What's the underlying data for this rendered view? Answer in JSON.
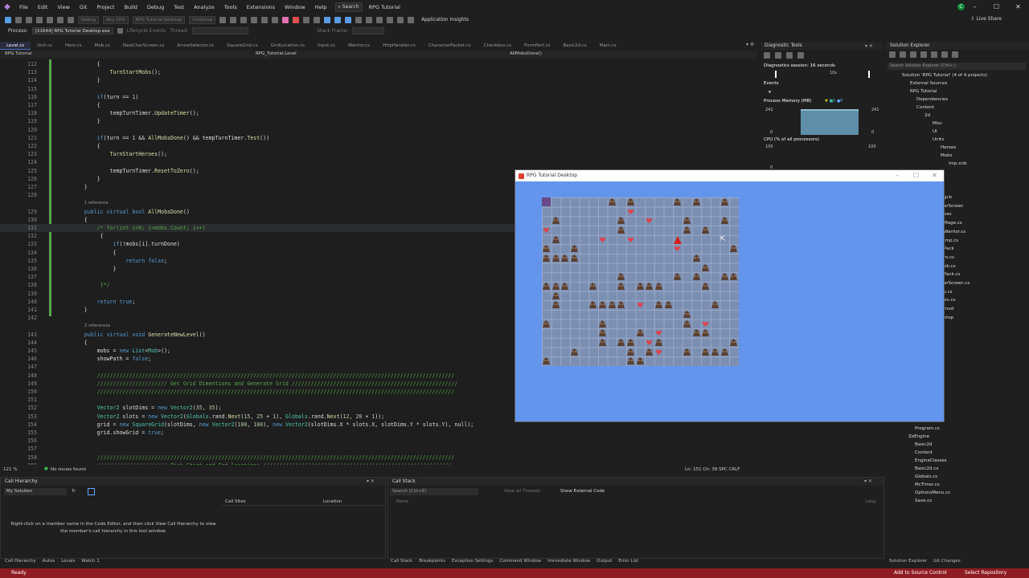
{
  "menu": {
    "items": [
      "File",
      "Edit",
      "View",
      "Git",
      "Project",
      "Build",
      "Debug",
      "Test",
      "Analyze",
      "Tools",
      "Extensions",
      "Window",
      "Help"
    ],
    "search_label": "Search",
    "window_title": "RPG Tutorial",
    "user_initial": "C"
  },
  "toolbar": {
    "config_select": "Debug",
    "platform_select": "Any CPU",
    "startup_select": "RPG Tutorial Desktop",
    "continue_label": "Continue",
    "app_insights": "Application Insights",
    "live_share": "Live Share"
  },
  "process_bar": {
    "process_label": "Process:",
    "process_value": "[21644] RPG Tutorial Desktop.exe",
    "lifecycle": "Lifecycle Events",
    "thread": "Thread:",
    "stack_frame": "Stack Frame:"
  },
  "tabs": [
    "Level.cs",
    "Unit.cs",
    "Hero.cs",
    "Mob.cs",
    "NewCharScreen.cs",
    "ArrowSelector.cs",
    "SquareGrid.cs",
    "GridLocation.cs",
    "Input.cs",
    "Warrior.cs",
    "HttpHandler.cs",
    "CharacterPacket.cs",
    "Checkbox.cs",
    "FormPart.cs",
    "Basic2d.cs",
    "Main.cs"
  ],
  "navbar": {
    "project": "RPG Tutorial",
    "class": "RPG_Tutorial.Level",
    "member": "AllMobsDone()"
  },
  "code_lines": [
    {
      "n": "112",
      "t": "            {"
    },
    {
      "n": "113",
      "t": "                TurnStartMobs();"
    },
    {
      "n": "114",
      "t": "            }"
    },
    {
      "n": "115",
      "t": ""
    },
    {
      "n": "116",
      "t": "            if(turn == 1)"
    },
    {
      "n": "117",
      "t": "            {"
    },
    {
      "n": "118",
      "t": "                tempTurnTimer.UpdateTimer();"
    },
    {
      "n": "119",
      "t": "            }"
    },
    {
      "n": "120",
      "t": ""
    },
    {
      "n": "121",
      "t": "            if(turn == 1 && AllMobsDone() && tempTurnTimer.Test())"
    },
    {
      "n": "122",
      "t": "            {"
    },
    {
      "n": "123",
      "t": "                TurnStartHeroes();"
    },
    {
      "n": "124",
      "t": ""
    },
    {
      "n": "125",
      "t": "                tempTurnTimer.ResetToZero();"
    },
    {
      "n": "126",
      "t": "            }"
    },
    {
      "n": "127",
      "t": "        }"
    },
    {
      "n": "128",
      "t": ""
    },
    {
      "n": "",
      "t": "",
      "lens": "1 reference"
    },
    {
      "n": "129",
      "t": "        public virtual bool AllMobsDone()"
    },
    {
      "n": "130",
      "t": "        {"
    },
    {
      "n": "131",
      "t": "            /* for(int i=0; i<mobs.Count; i++)"
    },
    {
      "n": "132",
      "t": "             {"
    },
    {
      "n": "133",
      "t": "                 if(!mobs[i].turnDone)"
    },
    {
      "n": "134",
      "t": "                 {"
    },
    {
      "n": "135",
      "t": "                     return false;"
    },
    {
      "n": "136",
      "t": "                 }"
    },
    {
      "n": "137",
      "t": ""
    },
    {
      "n": "138",
      "t": "             }*/"
    },
    {
      "n": "139",
      "t": ""
    },
    {
      "n": "140",
      "t": "            return true;"
    },
    {
      "n": "141",
      "t": "        }"
    },
    {
      "n": "142",
      "t": ""
    },
    {
      "n": "",
      "t": "",
      "lens": "2 references"
    },
    {
      "n": "143",
      "t": "        public virtual void GenerateNewLevel()"
    },
    {
      "n": "144",
      "t": "        {"
    },
    {
      "n": "145",
      "t": "            mobs = new List<Mob>();"
    },
    {
      "n": "146",
      "t": "            showPath = false;"
    },
    {
      "n": "147",
      "t": ""
    },
    {
      "n": "148",
      "t": "            ////////////////////////////////////////////////////////////////////////////////////////////////////////////////"
    },
    {
      "n": "149",
      "t": "            ////////////////////// Get Grid Dimentions and Generate Grid ////////////////////////////////////////////////////"
    },
    {
      "n": "150",
      "t": "            ////////////////////////////////////////////////////////////////////////////////////////////////////////////////"
    },
    {
      "n": "151",
      "t": ""
    },
    {
      "n": "152",
      "t": "            Vector2 slotDims = new Vector2(35, 35);"
    },
    {
      "n": "153",
      "t": "            Vector2 slots = new Vector2(Globals.rand.Next(15, 25 + 1), Globals.rand.Next(12, 20 + 1));"
    },
    {
      "n": "154",
      "t": "            grid = new SquareGrid(slotDims, new Vector2(100, 100), new Vector2(slotDims.X * slots.X, slotDims.Y * slots.Y), null);"
    },
    {
      "n": "155",
      "t": "            grid.showGrid = true;"
    },
    {
      "n": "156",
      "t": ""
    },
    {
      "n": "157",
      "t": ""
    },
    {
      "n": "158",
      "t": "            ////////////////////////////////////////////////////////////////////////////////////////////////////////////////"
    },
    {
      "n": "159",
      "t": "            ////////////////////// Pick Start and End locations ///////////////////////////////////////////////////////////"
    }
  ],
  "editor_status": {
    "zoom": "121 %",
    "issues": "No issues found",
    "position": "Ln: 151   Ch: 39   SPC   CRLF"
  },
  "diagnostics": {
    "title": "Diagnostic Tools",
    "session": "Diagnostics session: 16 seconds",
    "time_tick": "10s",
    "events": "Events",
    "process_memory": "Process Memory (MB)",
    "mem_max": "241",
    "mem_min": "0",
    "cpu": "CPU (% of all processors)",
    "cpu_max": "100",
    "cpu_min": "0"
  },
  "solution_explorer": {
    "title": "Solution Explorer",
    "search": "Search Solution Explorer (Ctrl+;)",
    "items": [
      "Solution 'RPG Tutorial' (4 of 4 projects)",
      "External Sources",
      "RPG Tutorial",
      "Dependencies",
      "Content",
      "2d",
      "Misc",
      "UI",
      "Units",
      "Heroes",
      "Mobs",
      "Imp.xnb"
    ],
    "lower_items": [
      "Program.cs",
      "ZeEngine",
      "Basic2d",
      "Content",
      "EngineClasses",
      "Basic2d.cs",
      "Globals.cs",
      "McTimer.cs",
      "OptionsMenu.cs",
      "Save.cs"
    ],
    "partial_items": [
      "gcb",
      "arScreen",
      "oes",
      "Mage.cs",
      "Warrior.cs",
      "Imp.cs",
      "Pack",
      "ro.cs",
      "ob.cs",
      "Pack.cs",
      "arScreen.cs",
      "s.cs",
      "en.cs",
      "mod",
      "ktop"
    ],
    "bottom_tabs": [
      "Solution Explorer",
      "Git Changes"
    ]
  },
  "call_hierarchy": {
    "title": "Call Hierarchy",
    "scope": "My Solution",
    "col_sites": "Call Sites",
    "col_location": "Location",
    "hint": "Right-click on a member name in the Code Editor, and then click View Call Hierarchy to view the member's call hierarchy in this tool window.",
    "tabs": [
      "Call Hierarchy",
      "Autos",
      "Locals",
      "Watch 1"
    ]
  },
  "call_stack": {
    "title": "Call Stack",
    "search": "Search (Ctrl+E)",
    "view_all": "View all Threads",
    "show_external": "Show External Code",
    "col_name": "Name",
    "col_lang": "Lang",
    "tabs": [
      "Call Stack",
      "Breakpoints",
      "Exception Settings",
      "Command Window",
      "Immediate Window",
      "Output",
      "Error List"
    ]
  },
  "statusbar": {
    "ready": "Ready",
    "source_control": "Add to Source Control",
    "repository": "Select Repository"
  },
  "game_window": {
    "title": "RPG Tutorial Desktop",
    "grid_cols": 21,
    "grid_rows": 18,
    "mob_cells": [
      [
        7,
        0
      ],
      [
        9,
        0
      ],
      [
        14,
        0
      ],
      [
        16,
        0
      ],
      [
        19,
        0
      ],
      [
        1,
        2
      ],
      [
        8,
        2
      ],
      [
        15,
        2
      ],
      [
        19,
        2
      ],
      [
        8,
        3
      ],
      [
        15,
        3
      ],
      [
        17,
        3
      ],
      [
        1,
        4
      ],
      [
        0,
        5
      ],
      [
        3,
        5
      ],
      [
        20,
        5
      ],
      [
        0,
        6
      ],
      [
        1,
        6
      ],
      [
        2,
        6
      ],
      [
        3,
        6
      ],
      [
        16,
        6
      ],
      [
        17,
        7
      ],
      [
        8,
        8
      ],
      [
        14,
        8
      ],
      [
        16,
        8
      ],
      [
        19,
        8
      ],
      [
        20,
        8
      ],
      [
        0,
        9
      ],
      [
        1,
        9
      ],
      [
        2,
        9
      ],
      [
        5,
        9
      ],
      [
        8,
        9
      ],
      [
        10,
        9
      ],
      [
        11,
        9
      ],
      [
        12,
        9
      ],
      [
        17,
        9
      ],
      [
        1,
        10
      ],
      [
        1,
        11
      ],
      [
        5,
        11
      ],
      [
        6,
        11
      ],
      [
        7,
        11
      ],
      [
        8,
        11
      ],
      [
        12,
        11
      ],
      [
        13,
        11
      ],
      [
        18,
        11
      ],
      [
        15,
        12
      ],
      [
        0,
        13
      ],
      [
        6,
        13
      ],
      [
        15,
        13
      ],
      [
        6,
        14
      ],
      [
        10,
        14
      ],
      [
        16,
        14
      ],
      [
        17,
        14
      ],
      [
        6,
        15
      ],
      [
        8,
        15
      ],
      [
        9,
        15
      ],
      [
        12,
        15
      ],
      [
        20,
        15
      ],
      [
        3,
        16
      ],
      [
        9,
        16
      ],
      [
        11,
        16
      ],
      [
        15,
        16
      ],
      [
        17,
        16
      ],
      [
        18,
        16
      ],
      [
        19,
        16
      ],
      [
        0,
        17
      ],
      [
        10,
        17
      ],
      [
        9,
        17
      ]
    ],
    "hero_cells": [
      [
        9,
        1
      ],
      [
        11,
        2
      ],
      [
        0,
        3
      ],
      [
        6,
        4
      ],
      [
        9,
        4
      ],
      [
        14,
        5
      ],
      [
        10,
        11
      ],
      [
        17,
        13
      ],
      [
        12,
        14
      ],
      [
        12,
        16
      ],
      [
        11,
        15
      ]
    ],
    "player_cell": [
      14,
      4
    ],
    "start_cell": [
      0,
      0
    ],
    "cursor_cell": [
      19,
      4
    ],
    "colors": {
      "background": "#6495ed",
      "grid": "#7b8fb2",
      "mob": "#5a4034",
      "hero": "#e0404a",
      "player": "#d42020"
    }
  }
}
